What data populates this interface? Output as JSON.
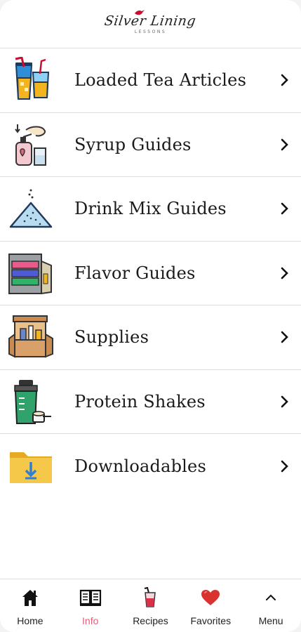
{
  "brand": {
    "logo_script": "Silver Lining",
    "logo_sub": "LESSONS"
  },
  "menu": {
    "items": [
      {
        "label": "Loaded Tea Articles",
        "icon": "loaded-tea-cup-icon"
      },
      {
        "label": "Syrup Guides",
        "icon": "syrup-pump-icon"
      },
      {
        "label": "Drink Mix Guides",
        "icon": "powder-pile-icon"
      },
      {
        "label": "Flavor Guides",
        "icon": "flavor-organizer-icon"
      },
      {
        "label": "Supplies",
        "icon": "supplies-box-icon"
      },
      {
        "label": "Protein Shakes",
        "icon": "shaker-bottle-icon"
      },
      {
        "label": "Downloadables",
        "icon": "download-folder-icon"
      }
    ]
  },
  "tabbar": {
    "tabs": [
      {
        "label": "Home",
        "icon": "home-icon",
        "active": false
      },
      {
        "label": "Info",
        "icon": "book-icon",
        "active": true
      },
      {
        "label": "Recipes",
        "icon": "drink-cup-icon",
        "active": false
      },
      {
        "label": "Favorites",
        "icon": "heart-icon",
        "active": false
      },
      {
        "label": "Menu",
        "icon": "chevron-up-icon",
        "active": false
      }
    ]
  },
  "colors": {
    "active_tab": "#e2607a",
    "divider": "#dedede",
    "text": "#1a1a1a"
  }
}
